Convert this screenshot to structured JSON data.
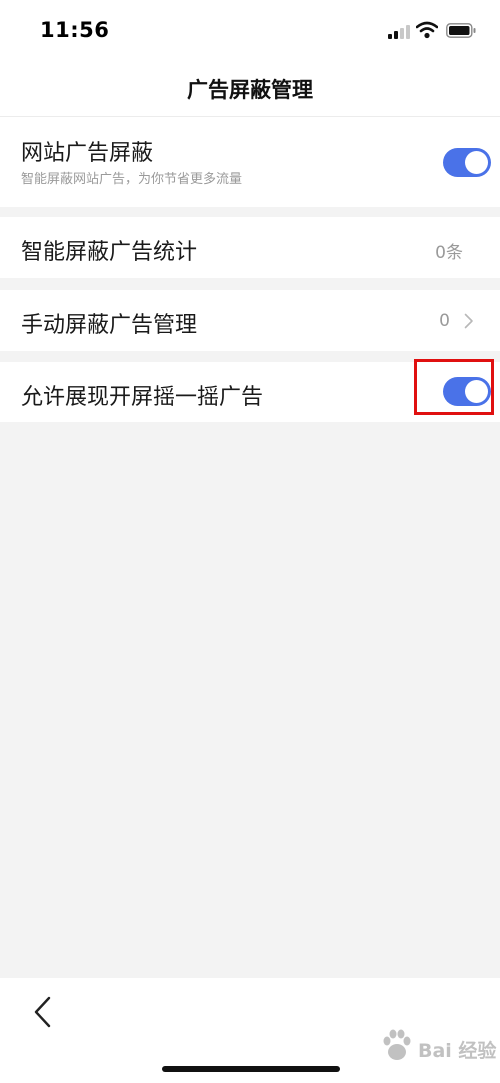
{
  "status_bar": {
    "time": "11:56",
    "icons": [
      "signal-icon",
      "wifi-icon",
      "battery-icon"
    ]
  },
  "header": {
    "title": "广告屏蔽管理"
  },
  "settings": {
    "website_ad_block": {
      "label": "网站广告屏蔽",
      "description": "智能屏蔽网站广告，为你节省更多流量",
      "enabled": true
    },
    "smart_block_stats": {
      "label": "智能屏蔽广告统计",
      "value": "0条"
    },
    "manual_block_manage": {
      "label": "手动屏蔽广告管理",
      "value": "0",
      "icon": "chevron-right-icon"
    },
    "allow_shake_ads": {
      "label": "允许展现开屏摇一摇广告",
      "enabled": true
    }
  },
  "bottom_bar": {
    "icon": "back-icon"
  },
  "watermark": {
    "text": "Bai 经验",
    "icon": "paw-logo-icon"
  },
  "colors": {
    "accent": "#4a72e8",
    "highlight": "#e01010",
    "background": "#f3f3f3"
  }
}
